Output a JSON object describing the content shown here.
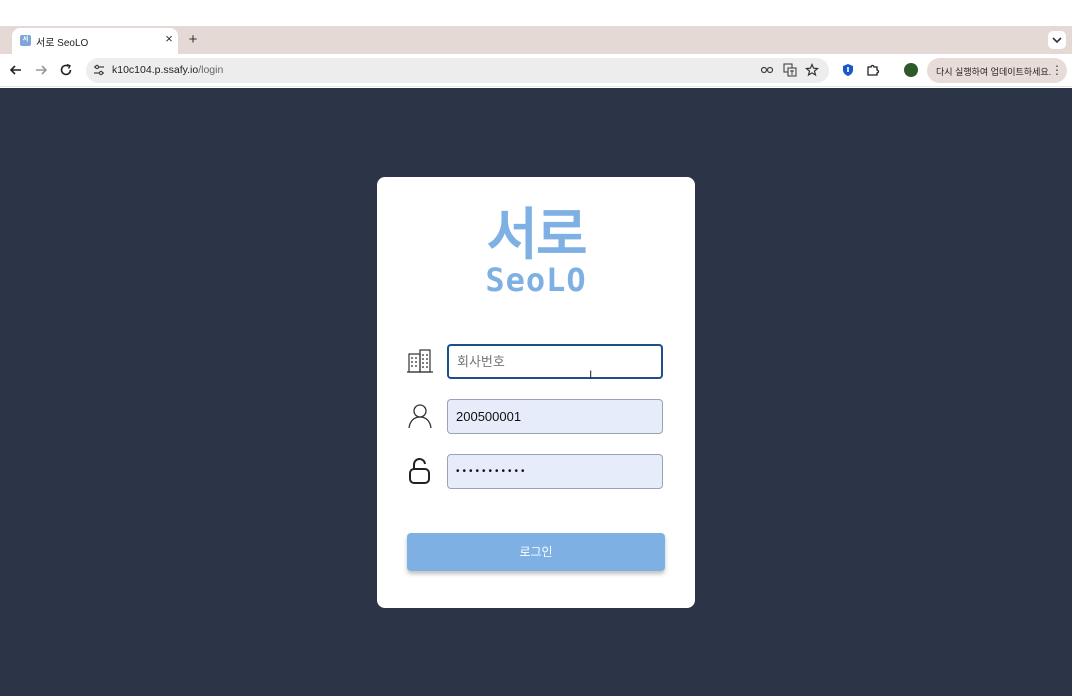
{
  "browser": {
    "tab": {
      "favicon_label": "서로",
      "title": "서로 SeoLO",
      "close_label": "×"
    },
    "new_tab_label": "+",
    "url": {
      "host": "k10c104.p.ssafy.io",
      "path": "/login"
    },
    "update_button": {
      "label": "다시 실행하여 업데이트하세요.",
      "menu_label": "⋮"
    },
    "profile": {
      "initials": ""
    }
  },
  "icons": {
    "back": "back-arrow-icon",
    "forward": "forward-arrow-icon",
    "reload": "reload-icon",
    "site_info": "tune-icon",
    "password": "key-icon",
    "translate": "translate-icon",
    "bookmark": "star-icon",
    "extension_shield": "shield-icon",
    "extensions": "puzzle-icon",
    "company": "building-icon",
    "user": "user-icon",
    "password_field": "unlock-icon"
  },
  "colors": {
    "page_background": "#2b3547",
    "card_background": "#ffffff",
    "brand": "#7fb0e4",
    "focus_border": "#1f4e8c",
    "autofill": "#e6ecfa"
  },
  "login": {
    "logo_korean": "서로",
    "logo_english": "SeoLO",
    "company_field": {
      "placeholder": "회사번호",
      "value": ""
    },
    "id_field": {
      "value": "200500001"
    },
    "password_field": {
      "masked_value": "•••••••••••"
    },
    "submit_label": "로그인"
  }
}
